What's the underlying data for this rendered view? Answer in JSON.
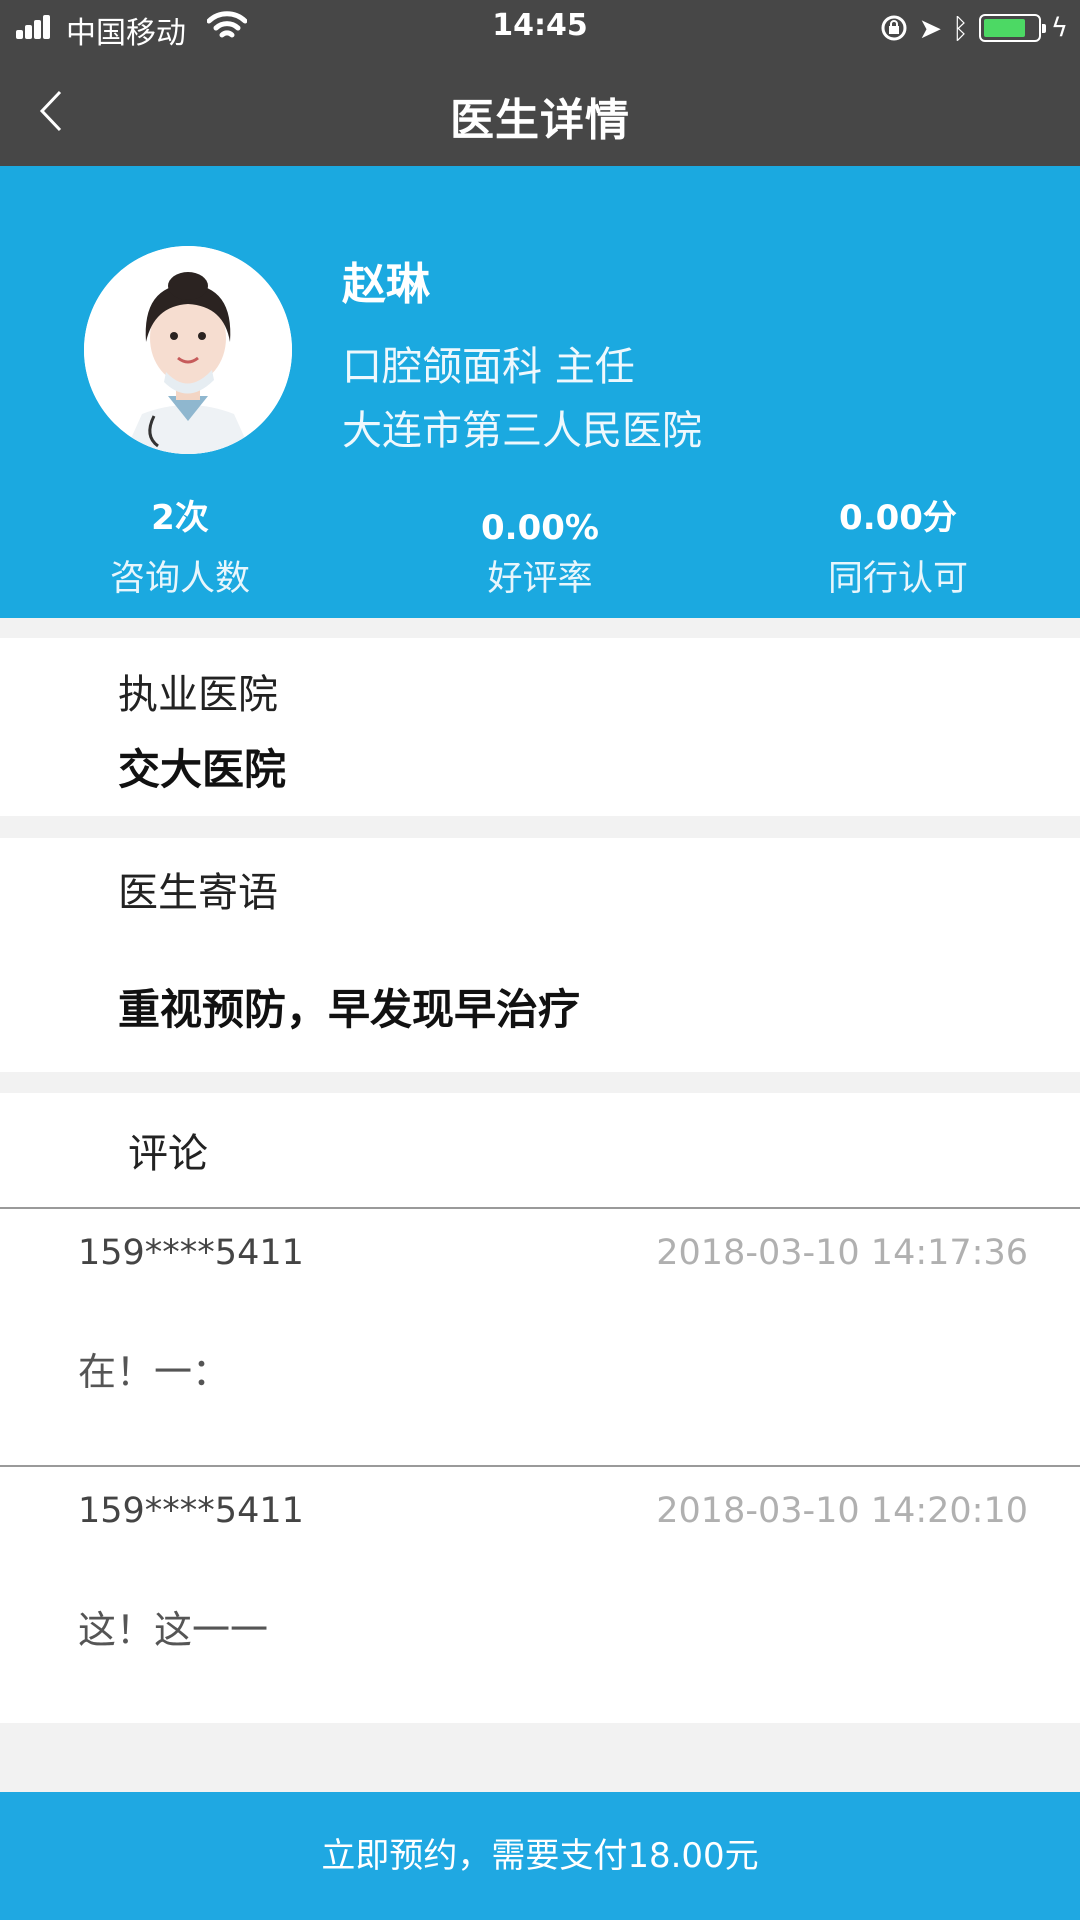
{
  "status_bar": {
    "carrier": "中国移动",
    "time": "14:45",
    "battery_level": 0.8
  },
  "nav": {
    "title": "医生详情"
  },
  "doctor": {
    "name": "赵琳",
    "department_title": "口腔颌面科 主任",
    "hospital": "大连市第三人民医院",
    "stats": [
      {
        "value": "2次",
        "label": "咨询人数"
      },
      {
        "value": "0.00%",
        "label": "好评率"
      },
      {
        "value": "0.00分",
        "label": "同行认可"
      }
    ]
  },
  "practice": {
    "label": "执业医院",
    "value": "交大医院"
  },
  "message": {
    "label": "医生寄语",
    "value": "重视预防，早发现早治疗"
  },
  "comments": {
    "heading": "评论",
    "items": [
      {
        "user": "159****5411",
        "time": "2018-03-10 14:17:36",
        "text": "在！一："
      },
      {
        "user": "159****5411",
        "time": "2018-03-10 14:20:10",
        "text": "这！这一一"
      }
    ]
  },
  "booking": {
    "label": "立即预约，需要支付18.00元"
  },
  "colors": {
    "header_bg": "#474747",
    "profile_bg": "#1ba9e0",
    "button_bg": "#1fa8e2",
    "page_bg": "#f2f2f2"
  }
}
